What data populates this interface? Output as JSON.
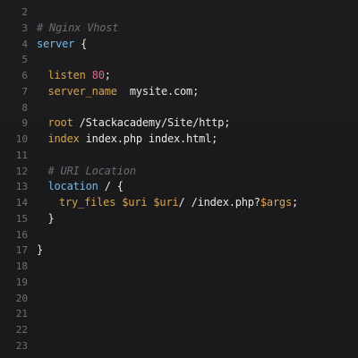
{
  "colors": {
    "background": "#1b1b1d",
    "line_number": "#6f6f72",
    "comment": "#6c6c70",
    "keyword": "#78b9e3",
    "directive": "#d3a44b",
    "number": "#d66b8c",
    "variable": "#e0a64e",
    "plain": "#e7e7e7"
  },
  "editor": {
    "lines": [
      {
        "num": "2",
        "indent": 0,
        "tokens": []
      },
      {
        "num": "3",
        "indent": 0,
        "tokens": [
          {
            "type": "comment",
            "text": "# Nginx Vhost"
          }
        ]
      },
      {
        "num": "4",
        "indent": 0,
        "tokens": [
          {
            "type": "keyword",
            "text": "server"
          },
          {
            "type": "plain",
            "text": " {"
          }
        ]
      },
      {
        "num": "5",
        "indent": 0,
        "tokens": []
      },
      {
        "num": "6",
        "indent": 1,
        "tokens": [
          {
            "type": "directive",
            "text": "listen"
          },
          {
            "type": "plain",
            "text": " "
          },
          {
            "type": "number",
            "text": "80"
          },
          {
            "type": "plain",
            "text": ";"
          }
        ]
      },
      {
        "num": "7",
        "indent": 1,
        "tokens": [
          {
            "type": "directive",
            "text": "server_name"
          },
          {
            "type": "plain",
            "text": "  mysite.com;"
          }
        ]
      },
      {
        "num": "8",
        "indent": 0,
        "tokens": []
      },
      {
        "num": "9",
        "indent": 1,
        "tokens": [
          {
            "type": "directive",
            "text": "root"
          },
          {
            "type": "plain",
            "text": " /Stackacademy/Site/http;"
          }
        ]
      },
      {
        "num": "10",
        "indent": 1,
        "tokens": [
          {
            "type": "directive",
            "text": "index"
          },
          {
            "type": "plain",
            "text": " index.php index.html;"
          }
        ]
      },
      {
        "num": "11",
        "indent": 0,
        "tokens": []
      },
      {
        "num": "12",
        "indent": 1,
        "tokens": [
          {
            "type": "comment",
            "text": "# URI Location"
          }
        ]
      },
      {
        "num": "13",
        "indent": 1,
        "tokens": [
          {
            "type": "keyword",
            "text": "location"
          },
          {
            "type": "plain",
            "text": " / {"
          }
        ]
      },
      {
        "num": "14",
        "indent": 2,
        "tokens": [
          {
            "type": "directive",
            "text": "try_files"
          },
          {
            "type": "plain",
            "text": " "
          },
          {
            "type": "var",
            "text": "$uri"
          },
          {
            "type": "plain",
            "text": " "
          },
          {
            "type": "var",
            "text": "$uri"
          },
          {
            "type": "plain",
            "text": "/ /index.php?"
          },
          {
            "type": "var",
            "text": "$args"
          },
          {
            "type": "plain",
            "text": ";"
          }
        ]
      },
      {
        "num": "15",
        "indent": 1,
        "tokens": [
          {
            "type": "plain",
            "text": "}"
          }
        ]
      },
      {
        "num": "16",
        "indent": 0,
        "tokens": []
      },
      {
        "num": "17",
        "indent": 0,
        "tokens": [
          {
            "type": "plain",
            "text": "}"
          }
        ]
      },
      {
        "num": "18",
        "indent": 0,
        "tokens": []
      },
      {
        "num": "19",
        "indent": 0,
        "tokens": []
      },
      {
        "num": "20",
        "indent": 0,
        "tokens": []
      },
      {
        "num": "21",
        "indent": 0,
        "tokens": []
      },
      {
        "num": "22",
        "indent": 0,
        "tokens": []
      },
      {
        "num": "23",
        "indent": 0,
        "tokens": []
      }
    ]
  }
}
